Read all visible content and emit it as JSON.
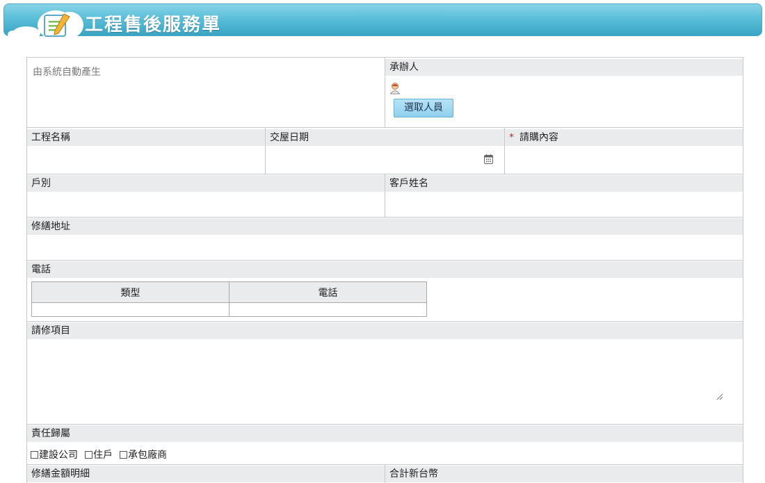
{
  "header": {
    "title": "工程售後服務單"
  },
  "form": {
    "auto_text": "由系統自動產生",
    "handler": {
      "label": "承辦人",
      "button": "選取人員"
    },
    "project_name": {
      "label": "工程名稱"
    },
    "handover_date": {
      "label": "交屋日期"
    },
    "purchase_content": {
      "label": "請購內容",
      "required_mark": "*"
    },
    "unit": {
      "label": "戶別"
    },
    "customer_name": {
      "label": "客戶姓名"
    },
    "repair_address": {
      "label": "修繕地址"
    },
    "phone": {
      "label": "電話",
      "columns": [
        "類型",
        "電話"
      ]
    },
    "repair_items": {
      "label": "請修項目"
    },
    "responsibility": {
      "label": "責任歸屬",
      "options": [
        "建設公司",
        "住戶",
        "承包廠商"
      ]
    },
    "repair_cost_detail": {
      "label": "修繕金額明細"
    },
    "total_ntd": {
      "label": "合計新台幣"
    }
  },
  "icons": [
    "cloud-logo-icon",
    "person-icon",
    "calendar-icon",
    "resize-grip-icon"
  ],
  "colors": {
    "banner": "#5bbfd9",
    "label_bg": "#e9ebed",
    "button": "#8fd0ee",
    "required": "#d81e1e"
  }
}
